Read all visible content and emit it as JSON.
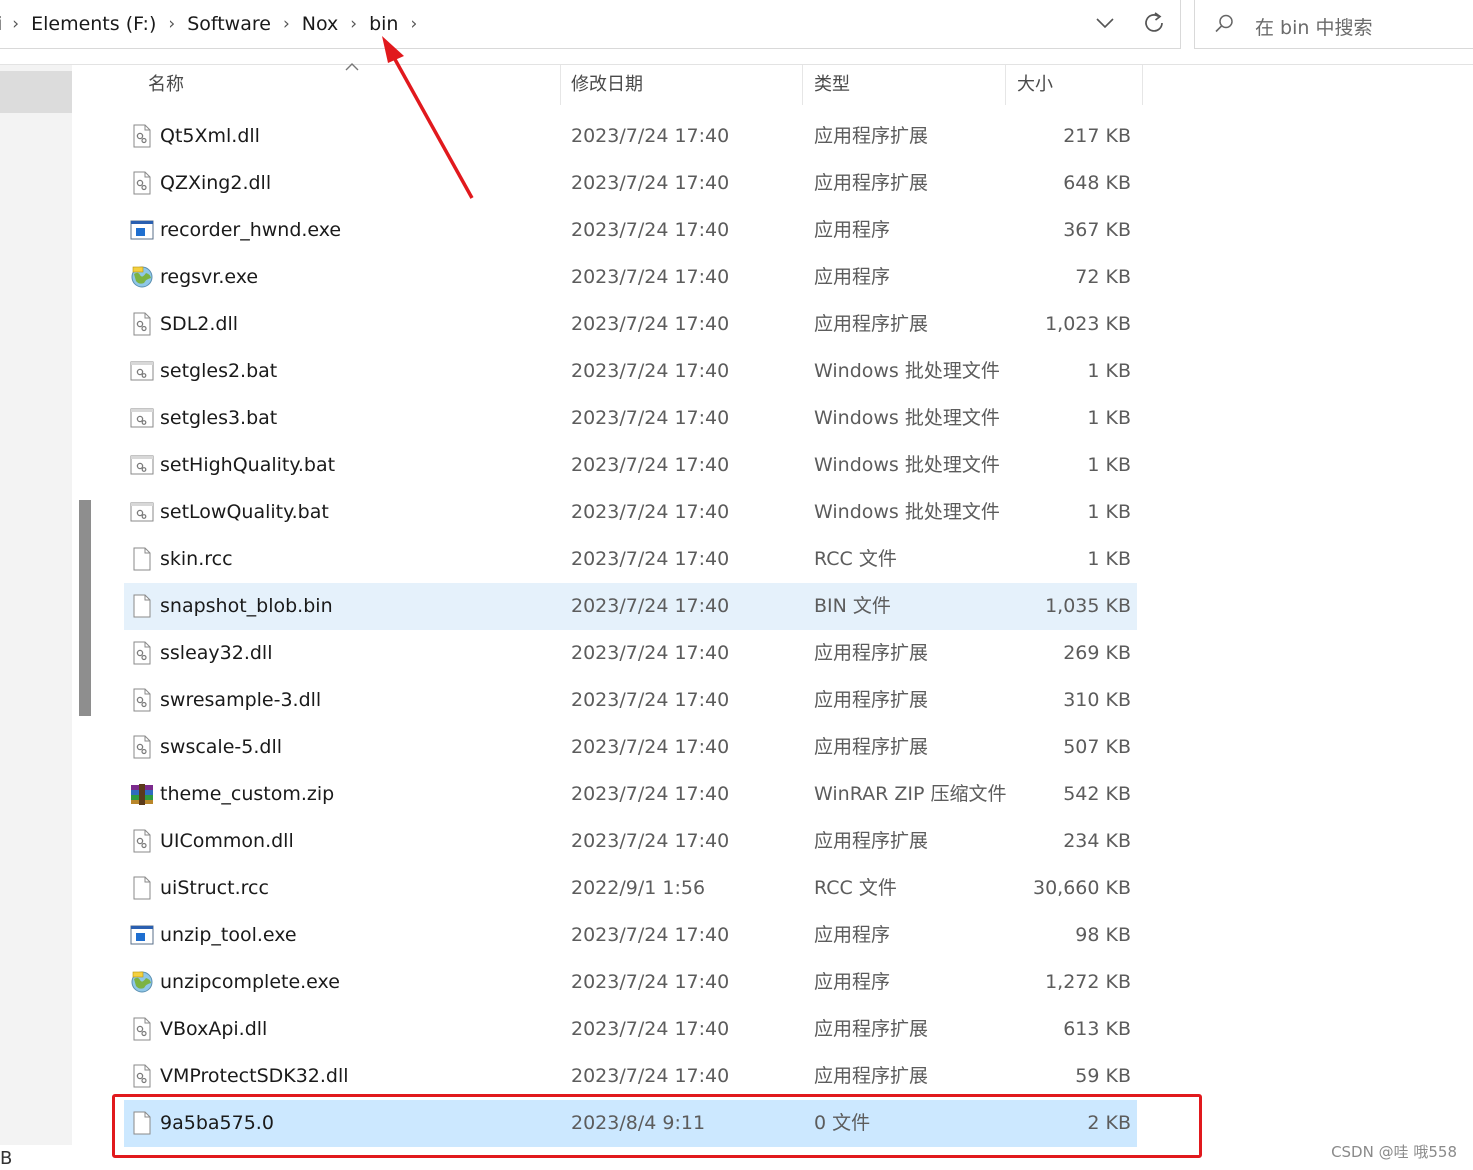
{
  "breadcrumb": {
    "items": [
      "Elements (F:)",
      "Software",
      "Nox",
      "bin"
    ],
    "separator": "›"
  },
  "search": {
    "placeholder": "在 bin 中搜索"
  },
  "columns": {
    "name": "名称",
    "modified": "修改日期",
    "type": "类型",
    "size": "大小"
  },
  "nav": {
    "edge_glyph": "i",
    "bottom_glyph": "B"
  },
  "files": [
    {
      "name": "Qt5Xml.dll",
      "date": "2023/7/24 17:40",
      "type": "应用程序扩展",
      "size": "217 KB",
      "icon": "dll-icon"
    },
    {
      "name": "QZXing2.dll",
      "date": "2023/7/24 17:40",
      "type": "应用程序扩展",
      "size": "648 KB",
      "icon": "dll-icon"
    },
    {
      "name": "recorder_hwnd.exe",
      "date": "2023/7/24 17:40",
      "type": "应用程序",
      "size": "367 KB",
      "icon": "exe-icon"
    },
    {
      "name": "regsvr.exe",
      "date": "2023/7/24 17:40",
      "type": "应用程序",
      "size": "72 KB",
      "icon": "globe-exe-icon"
    },
    {
      "name": "SDL2.dll",
      "date": "2023/7/24 17:40",
      "type": "应用程序扩展",
      "size": "1,023 KB",
      "icon": "dll-icon"
    },
    {
      "name": "setgles2.bat",
      "date": "2023/7/24 17:40",
      "type": "Windows 批处理文件",
      "size": "1 KB",
      "icon": "bat-icon"
    },
    {
      "name": "setgles3.bat",
      "date": "2023/7/24 17:40",
      "type": "Windows 批处理文件",
      "size": "1 KB",
      "icon": "bat-icon"
    },
    {
      "name": "setHighQuality.bat",
      "date": "2023/7/24 17:40",
      "type": "Windows 批处理文件",
      "size": "1 KB",
      "icon": "bat-icon"
    },
    {
      "name": "setLowQuality.bat",
      "date": "2023/7/24 17:40",
      "type": "Windows 批处理文件",
      "size": "1 KB",
      "icon": "bat-icon"
    },
    {
      "name": "skin.rcc",
      "date": "2023/7/24 17:40",
      "type": "RCC 文件",
      "size": "1 KB",
      "icon": "blank-file-icon"
    },
    {
      "name": "snapshot_blob.bin",
      "date": "2023/7/24 17:40",
      "type": "BIN 文件",
      "size": "1,035 KB",
      "icon": "blank-file-icon",
      "state": "hover"
    },
    {
      "name": "ssleay32.dll",
      "date": "2023/7/24 17:40",
      "type": "应用程序扩展",
      "size": "269 KB",
      "icon": "dll-icon"
    },
    {
      "name": "swresample-3.dll",
      "date": "2023/7/24 17:40",
      "type": "应用程序扩展",
      "size": "310 KB",
      "icon": "dll-icon"
    },
    {
      "name": "swscale-5.dll",
      "date": "2023/7/24 17:40",
      "type": "应用程序扩展",
      "size": "507 KB",
      "icon": "dll-icon"
    },
    {
      "name": "theme_custom.zip",
      "date": "2023/7/24 17:40",
      "type": "WinRAR ZIP 压缩文件",
      "size": "542 KB",
      "icon": "winrar-icon"
    },
    {
      "name": "UICommon.dll",
      "date": "2023/7/24 17:40",
      "type": "应用程序扩展",
      "size": "234 KB",
      "icon": "dll-icon"
    },
    {
      "name": "uiStruct.rcc",
      "date": "2022/9/1 1:56",
      "type": "RCC 文件",
      "size": "30,660 KB",
      "icon": "blank-file-icon"
    },
    {
      "name": "unzip_tool.exe",
      "date": "2023/7/24 17:40",
      "type": "应用程序",
      "size": "98 KB",
      "icon": "exe-icon"
    },
    {
      "name": "unzipcomplete.exe",
      "date": "2023/7/24 17:40",
      "type": "应用程序",
      "size": "1,272 KB",
      "icon": "globe-exe-icon"
    },
    {
      "name": "VBoxApi.dll",
      "date": "2023/7/24 17:40",
      "type": "应用程序扩展",
      "size": "613 KB",
      "icon": "dll-icon"
    },
    {
      "name": "VMProtectSDK32.dll",
      "date": "2023/7/24 17:40",
      "type": "应用程序扩展",
      "size": "59 KB",
      "icon": "dll-icon"
    },
    {
      "name": "9a5ba575.0",
      "date": "2023/8/4 9:11",
      "type": "0 文件",
      "size": "2 KB",
      "icon": "blank-file-icon",
      "state": "selected"
    }
  ],
  "colors": {
    "hover_row": "#e5f1fb",
    "selected_row": "#cce8ff",
    "annotation_red": "#e1191d"
  },
  "watermark": "CSDN @哇 哦558"
}
